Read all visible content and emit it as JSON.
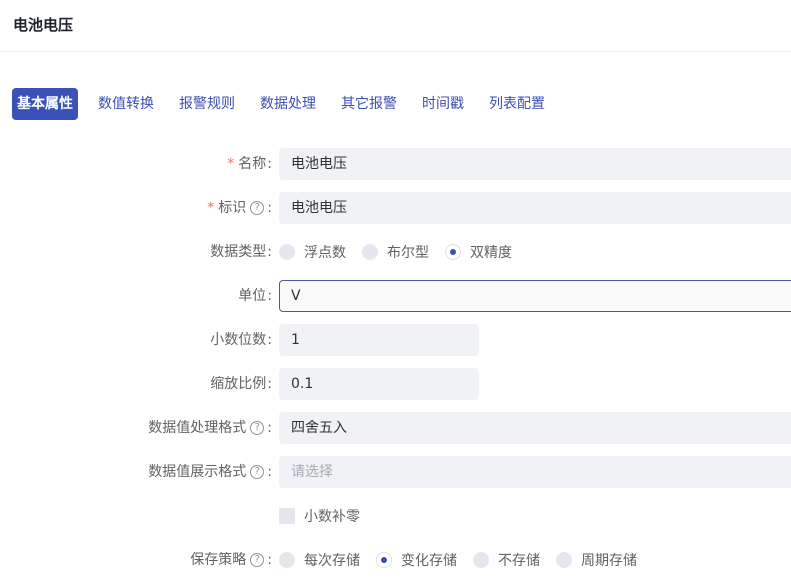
{
  "header": {
    "title": "电池电压"
  },
  "tabs": [
    {
      "label": "基本属性"
    },
    {
      "label": "数值转换"
    },
    {
      "label": "报警规则"
    },
    {
      "label": "数据处理"
    },
    {
      "label": "其它报警"
    },
    {
      "label": "时间戳"
    },
    {
      "label": "列表配置"
    }
  ],
  "form": {
    "colon": ":",
    "help_glyph": "?",
    "required_mark": "*",
    "name": {
      "label": "名称",
      "value": "电池电压"
    },
    "identifier": {
      "label": "标识",
      "value": "电池电压"
    },
    "data_type": {
      "label": "数据类型",
      "options": [
        "浮点数",
        "布尔型",
        "双精度"
      ],
      "selected": "双精度"
    },
    "unit": {
      "label": "单位",
      "value": "V"
    },
    "decimals": {
      "label": "小数位数",
      "value": "1"
    },
    "scale": {
      "label": "缩放比例",
      "value": "0.1"
    },
    "processing_format": {
      "label": "数据值处理格式",
      "value": "四舍五入"
    },
    "display_format": {
      "label": "数据值展示格式",
      "placeholder": "请选择"
    },
    "pad_zero": {
      "label": "小数补零",
      "checked": false
    },
    "save_strategy": {
      "label": "保存策略",
      "options": [
        "每次存储",
        "变化存储",
        "不存储",
        "周期存储"
      ],
      "selected": "变化存储"
    }
  }
}
